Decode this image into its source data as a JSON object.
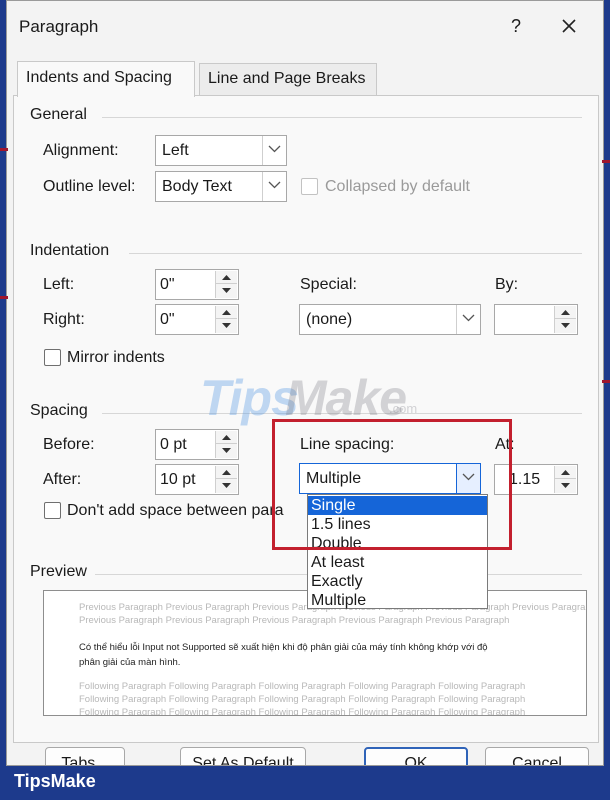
{
  "dialog": {
    "title": "Paragraph",
    "help_glyph": "?",
    "close_glyph": "✕"
  },
  "tabs": [
    {
      "label": "Indents and Spacing",
      "active": true
    },
    {
      "label": "Line and Page Breaks",
      "active": false
    }
  ],
  "general": {
    "section_label": "General",
    "alignment_label": "Alignment:",
    "alignment_value": "Left",
    "outline_label": "Outline level:",
    "outline_value": "Body Text",
    "collapsed_label": "Collapsed by default"
  },
  "indentation": {
    "section_label": "Indentation",
    "left_label": "Left:",
    "left_value": "0\"",
    "right_label": "Right:",
    "right_value": "0\"",
    "special_label": "Special:",
    "special_value": "(none)",
    "by_label": "By:",
    "by_value": "",
    "mirror_label": "Mirror indents"
  },
  "spacing": {
    "section_label": "Spacing",
    "before_label": "Before:",
    "before_value": "0 pt",
    "after_label": "After:",
    "after_value": "10 pt",
    "line_spacing_label": "Line spacing:",
    "line_spacing_value": "Multiple",
    "at_label": "At:",
    "at_value": "1.15",
    "dont_add_label": "Don't add space between para"
  },
  "line_spacing_options": [
    "Single",
    "1.5 lines",
    "Double",
    "At least",
    "Exactly",
    "Multiple"
  ],
  "line_spacing_selected": "Single",
  "preview": {
    "section_label": "Preview",
    "previous_line_1": "Previous Paragraph Previous Paragraph Previous Paragraph Previous Paragraph Previous Paragraph Previous Paragraph",
    "previous_line_2": "Previous Paragraph Previous Paragraph Previous Paragraph Previous Paragraph Previous Paragraph",
    "sample_line_1": "Có thể hiểu lỗi Input not Supported sẽ xuất hiện khi độ phân giải của máy tính không khớp với độ",
    "sample_line_2": "phân giải của màn hình.",
    "following_line_1": "Following Paragraph Following Paragraph Following Paragraph Following Paragraph Following Paragraph",
    "following_line_2": "Following Paragraph Following Paragraph Following Paragraph Following Paragraph Following Paragraph",
    "following_line_3": "Following Paragraph Following Paragraph Following Paragraph Following Paragraph Following Paragraph"
  },
  "buttons": {
    "tabs": "Tabs...",
    "set_default": "Set As Default",
    "ok": "OK",
    "cancel": "Cancel"
  },
  "watermark": {
    "part1": "Tips",
    "part2": "Make",
    "suffix": ".com"
  },
  "brand": "TipsMake",
  "colors": {
    "selection": "#1565d8",
    "highlight_box": "#c3202e",
    "brand_bar": "#1d3a8c"
  }
}
